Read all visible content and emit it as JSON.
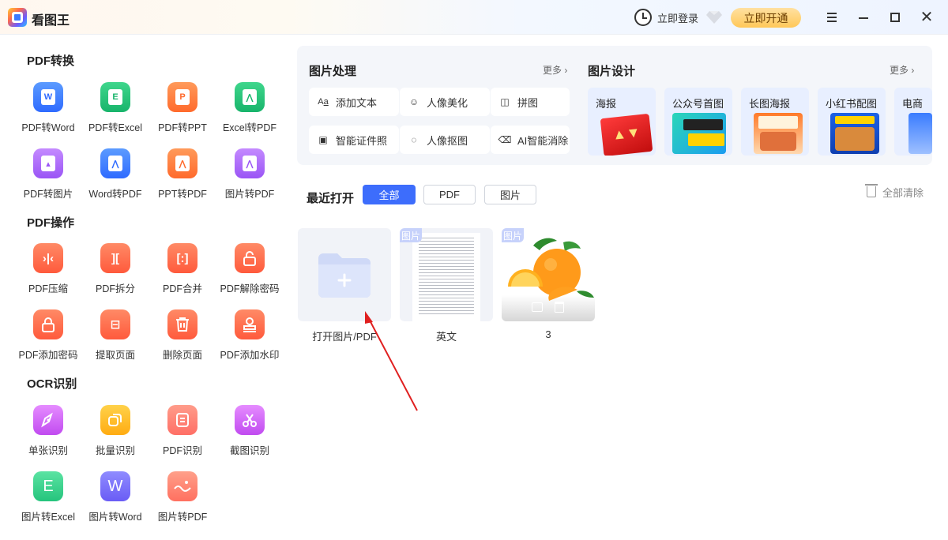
{
  "app": {
    "name": "看图王"
  },
  "titlebar": {
    "login_label": "立即登录",
    "vip_label": "立即开通"
  },
  "sidebar": {
    "sections": [
      {
        "title": "PDF转换",
        "items": [
          {
            "label": "PDF转Word",
            "icon": "word-doc-icon",
            "color": "#2f6bff"
          },
          {
            "label": "PDF转Excel",
            "icon": "excel-doc-icon",
            "color": "#18b46b"
          },
          {
            "label": "PDF转PPT",
            "icon": "ppt-doc-icon",
            "color": "#ff6a2c"
          },
          {
            "label": "Excel转PDF",
            "icon": "pdf-doc-icon",
            "color": "#18b46b"
          },
          {
            "label": "PDF转图片",
            "icon": "image-doc-icon",
            "color": "#9a55f5"
          },
          {
            "label": "Word转PDF",
            "icon": "pdf-doc-icon",
            "color": "#2f6bff"
          },
          {
            "label": "PPT转PDF",
            "icon": "pdf-doc-icon",
            "color": "#ff6a2c"
          },
          {
            "label": "图片转PDF",
            "icon": "pdf-doc-icon",
            "color": "#9a55f5"
          }
        ]
      },
      {
        "title": "PDF操作",
        "items": [
          {
            "label": "PDF压缩",
            "icon": "compress-icon",
            "color": "#ff5a3c"
          },
          {
            "label": "PDF拆分",
            "icon": "split-icon",
            "color": "#ff5a3c"
          },
          {
            "label": "PDF合并",
            "icon": "merge-icon",
            "color": "#ff5a3c"
          },
          {
            "label": "PDF解除密码",
            "icon": "unlock-icon",
            "color": "#ff5a3c"
          },
          {
            "label": "PDF添加密码",
            "icon": "lock-icon",
            "color": "#ff5a3c"
          },
          {
            "label": "提取页面",
            "icon": "extract-icon",
            "color": "#ff5a3c"
          },
          {
            "label": "删除页面",
            "icon": "delete-page-icon",
            "color": "#ff5a3c"
          },
          {
            "label": "PDF添加水印",
            "icon": "stamp-icon",
            "color": "#ff5a3c"
          }
        ]
      },
      {
        "title": "OCR识别",
        "items": [
          {
            "label": "单张识别",
            "icon": "single-scan-icon",
            "color": "#c14bf0"
          },
          {
            "label": "批量识别",
            "icon": "batch-scan-icon",
            "color": "#ffac12"
          },
          {
            "label": "PDF识别",
            "icon": "pdf-scan-icon",
            "color": "#ff6f66"
          },
          {
            "label": "截图识别",
            "icon": "scissors-icon",
            "color": "#c14bf0"
          },
          {
            "label": "图片转Excel",
            "icon": "excel-letter-icon",
            "color": "#25c47d"
          },
          {
            "label": "图片转Word",
            "icon": "word-letter-icon",
            "color": "#6a5cf5"
          },
          {
            "label": "图片转PDF",
            "icon": "image-wave-icon",
            "color": "#ff7060"
          }
        ]
      }
    ]
  },
  "image_process": {
    "title": "图片处理",
    "more": "更多",
    "buttons": [
      {
        "label": "添加文本",
        "icon": "text-aa-icon"
      },
      {
        "label": "人像美化",
        "icon": "portrait-beauty-icon"
      },
      {
        "label": "拼图",
        "icon": "collage-icon"
      },
      {
        "label": "智能证件照",
        "icon": "id-photo-icon"
      },
      {
        "label": "人像抠图",
        "icon": "cutout-icon"
      },
      {
        "label": "AI智能消除",
        "icon": "eraser-icon"
      }
    ]
  },
  "image_design": {
    "title": "图片设计",
    "more": "更多",
    "cards": [
      {
        "label": "海报"
      },
      {
        "label": "公众号首图"
      },
      {
        "label": "长图海报"
      },
      {
        "label": "小红书配图"
      },
      {
        "label": "电商"
      }
    ]
  },
  "recent": {
    "title": "最近打开",
    "filters": [
      {
        "label": "全部",
        "active": true
      },
      {
        "label": "PDF",
        "active": false
      },
      {
        "label": "图片",
        "active": false
      }
    ],
    "clear_label": "全部清除",
    "badge_label": "图片",
    "files": [
      {
        "name": "打开图片/PDF",
        "type": "open"
      },
      {
        "name": "英文",
        "type": "document"
      },
      {
        "name": "3",
        "type": "photo"
      }
    ]
  },
  "colors": {
    "accent": "#3d6dfc",
    "vip": "#ffc858",
    "annotation_arrow": "#e02020"
  }
}
